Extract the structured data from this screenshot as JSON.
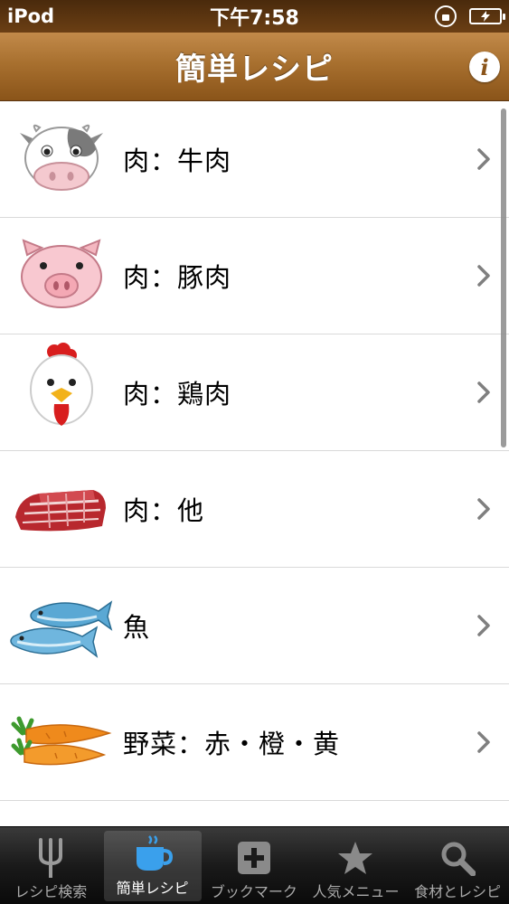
{
  "status_bar": {
    "carrier": "iPod",
    "time": "下午7:58",
    "battery_icon": "battery-charging-icon",
    "lock_icon": "orientation-lock-icon"
  },
  "nav_bar": {
    "title": "簡単レシピ",
    "info_label": "i"
  },
  "list": {
    "items": [
      {
        "label": "肉：牛肉",
        "icon": "cow-icon"
      },
      {
        "label": "肉：豚肉",
        "icon": "pig-icon"
      },
      {
        "label": "肉：鶏肉",
        "icon": "chicken-icon"
      },
      {
        "label": "肉：他",
        "icon": "meat-icon"
      },
      {
        "label": "魚",
        "icon": "fish-icon"
      },
      {
        "label": "野菜：赤・橙・黄",
        "icon": "carrot-icon"
      }
    ]
  },
  "tab_bar": {
    "tabs": [
      {
        "label": "レシピ検索",
        "icon": "fork-icon",
        "active": false
      },
      {
        "label": "簡単レシピ",
        "icon": "cup-icon",
        "active": true
      },
      {
        "label": "ブックマーク",
        "icon": "plus-icon",
        "active": false
      },
      {
        "label": "人気メニュー",
        "icon": "star-icon",
        "active": false
      },
      {
        "label": "食材とレシピ",
        "icon": "search-icon",
        "active": false
      }
    ]
  },
  "colors": {
    "nav_brown": "#a8702f",
    "status_brown": "#4a2a0c"
  }
}
